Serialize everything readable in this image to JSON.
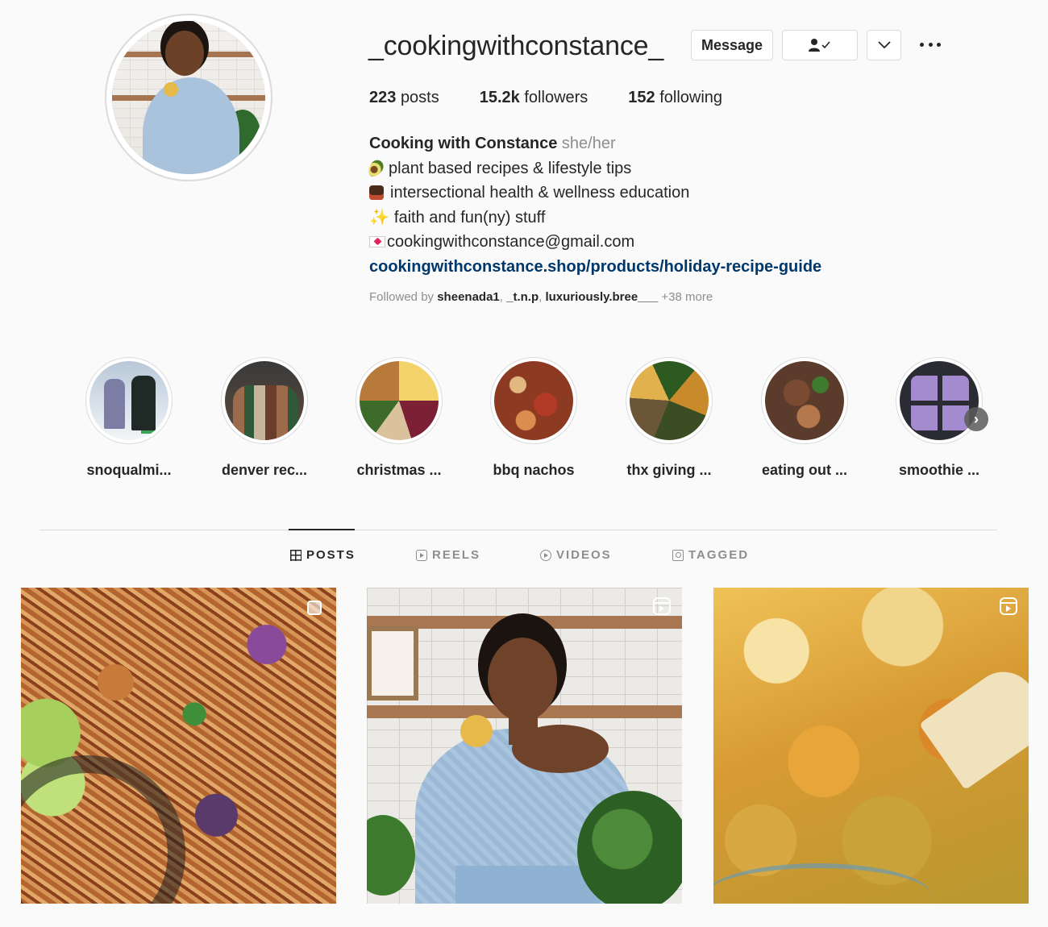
{
  "profile": {
    "username": "_cookingwithconstance_",
    "buttons": {
      "message": "Message",
      "follow_icon": "person-check-icon",
      "dropdown_icon": "chevron-down-icon",
      "more_icon": "ellipsis-icon"
    },
    "stats": {
      "posts_count": "223",
      "posts_label": "posts",
      "followers_count": "15.2k",
      "followers_label": "followers",
      "following_count": "152",
      "following_label": "following"
    },
    "bio": {
      "name": "Cooking with Constance",
      "pronouns": "she/her",
      "lines": [
        {
          "icon": "avocado-icon",
          "text": "plant based recipes & lifestyle tips"
        },
        {
          "icon": "teacher-icon",
          "text": "intersectional health & wellness education"
        },
        {
          "icon": "sparkles-icon",
          "text": "faith and fun(ny) stuff"
        },
        {
          "icon": "love-letter-icon",
          "text": "cookingwithconstance@gmail.com"
        }
      ],
      "link": "cookingwithconstance.shop/products/holiday-recipe-guide"
    },
    "followed_by": {
      "prefix": "Followed by",
      "users": [
        "sheenada1",
        "_t.n.p",
        "luxuriously.bree___"
      ],
      "more": "+38 more"
    }
  },
  "highlights": [
    {
      "label": "snoqualmi...",
      "thumb": "snow-group-photo"
    },
    {
      "label": "denver rec...",
      "thumb": "friends-group-photo"
    },
    {
      "label": "christmas ...",
      "thumb": "christmas-food-photo"
    },
    {
      "label": "bbq nachos",
      "thumb": "nachos-photo"
    },
    {
      "label": "thx giving ...",
      "thumb": "thanksgiving-plate-photo"
    },
    {
      "label": "eating out ...",
      "thumb": "restaurant-food-photo"
    },
    {
      "label": "smoothie ...",
      "thumb": "smoothie-cubes-photo"
    }
  ],
  "tabs": [
    {
      "label": "POSTS",
      "icon": "grid-icon",
      "active": true
    },
    {
      "label": "REELS",
      "icon": "reels-icon",
      "active": false
    },
    {
      "label": "VIDEOS",
      "icon": "video-icon",
      "active": false
    },
    {
      "label": "TAGGED",
      "icon": "tagged-icon",
      "active": false
    }
  ],
  "posts": [
    {
      "subject": "pad thai noodles",
      "badge": "multi-post-icon"
    },
    {
      "subject": "woman holding peach",
      "badge": "reel-icon"
    },
    {
      "subject": "cheesy dip",
      "badge": "reel-icon"
    }
  ],
  "colors": {
    "text": "#262626",
    "muted": "#8e8e8e",
    "link": "#00376b",
    "border": "#dbdbdb",
    "background": "#fafafa"
  }
}
